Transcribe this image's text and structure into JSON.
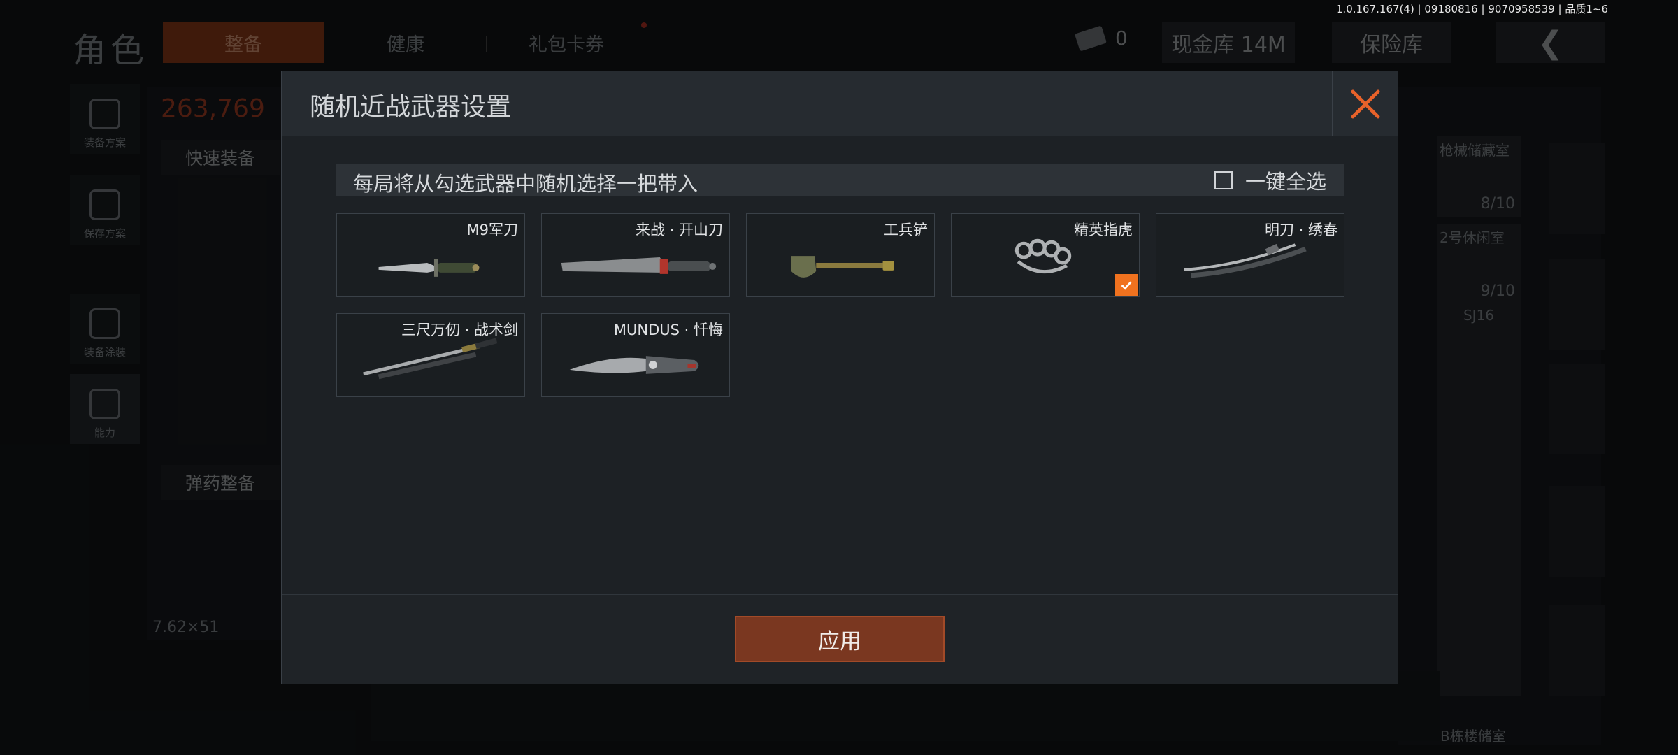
{
  "version_text": "1.0.167.167(4) | 09180816 | 9070958539 | 品质1~6",
  "background": {
    "title": "角色",
    "tabs": [
      {
        "label": "整备"
      },
      {
        "label": "健康"
      },
      {
        "label": "礼包卡券"
      }
    ],
    "cash_count": "0",
    "cash_button": "现金库 14M",
    "safe_button": "保险库",
    "back_icon": "chevron-left-icon",
    "sidebar": [
      {
        "label": "装备方案",
        "icon": "vest-icon"
      },
      {
        "label": "保存方案",
        "icon": "download-icon"
      },
      {
        "label": "装备涂装",
        "icon": "helmet-icon"
      },
      {
        "label": "能力",
        "icon": "lightning-icon"
      }
    ],
    "left_panel": {
      "value": "263,769",
      "quick_equip": "快速装备",
      "ammo_equip": "弹药整备",
      "ammo_caliber": "7.62×51"
    },
    "right_panel": {
      "cells": [
        {
          "title": "枪械储藏室",
          "value": "8/10"
        },
        {
          "title": "2号休闲室",
          "value": "9/10"
        },
        {
          "title": "SJ16"
        },
        {
          "title": "B栋楼储室"
        }
      ]
    }
  },
  "modal": {
    "title": "随机近战武器设置",
    "info_text": "每局将从勾选武器中随机选择一把带入",
    "select_all_label": "一键全选",
    "select_all_checked": false,
    "apply_label": "应用",
    "accent_color": "#f0721f",
    "weapons": [
      {
        "name": "M9军刀",
        "icon": "combat-knife-icon",
        "checked": false
      },
      {
        "name": "来战 · 开山刀",
        "icon": "machete-icon",
        "checked": false
      },
      {
        "name": "工兵铲",
        "icon": "shovel-icon",
        "checked": false
      },
      {
        "name": "精英指虎",
        "icon": "brass-knuckles-icon",
        "checked": true
      },
      {
        "name": "明刀 · 绣春",
        "icon": "katana-icon",
        "checked": false
      },
      {
        "name": "三尺万仞 · 战术剑",
        "icon": "sword-icon",
        "checked": false
      },
      {
        "name": "MUNDUS · 忏悔",
        "icon": "folding-knife-icon",
        "checked": false
      }
    ]
  }
}
